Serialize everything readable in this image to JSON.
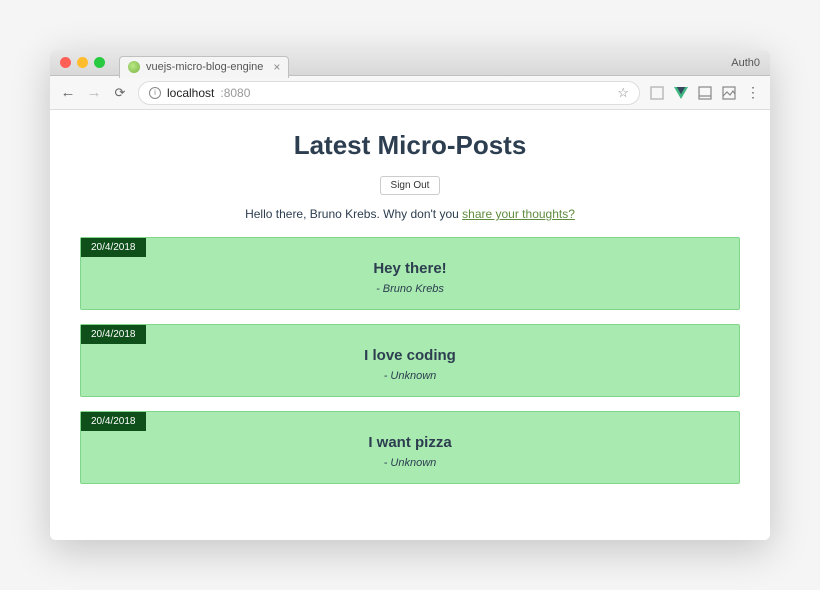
{
  "browser": {
    "tab_title": "vuejs-micro-blog-engine",
    "profile_label": "Auth0",
    "url_host": "localhost",
    "url_port": ":8080"
  },
  "page": {
    "title": "Latest Micro-Posts",
    "signout_label": "Sign Out",
    "greeting_prefix": "Hello there, ",
    "user_name": "Bruno Krebs",
    "greeting_mid": ". Why don't you ",
    "share_link_text": "share your thoughts?"
  },
  "posts": [
    {
      "date": "20/4/2018",
      "title": "Hey there!",
      "author": "- Bruno Krebs"
    },
    {
      "date": "20/4/2018",
      "title": "I love coding",
      "author": "- Unknown"
    },
    {
      "date": "20/4/2018",
      "title": "I want pizza",
      "author": "- Unknown"
    }
  ]
}
